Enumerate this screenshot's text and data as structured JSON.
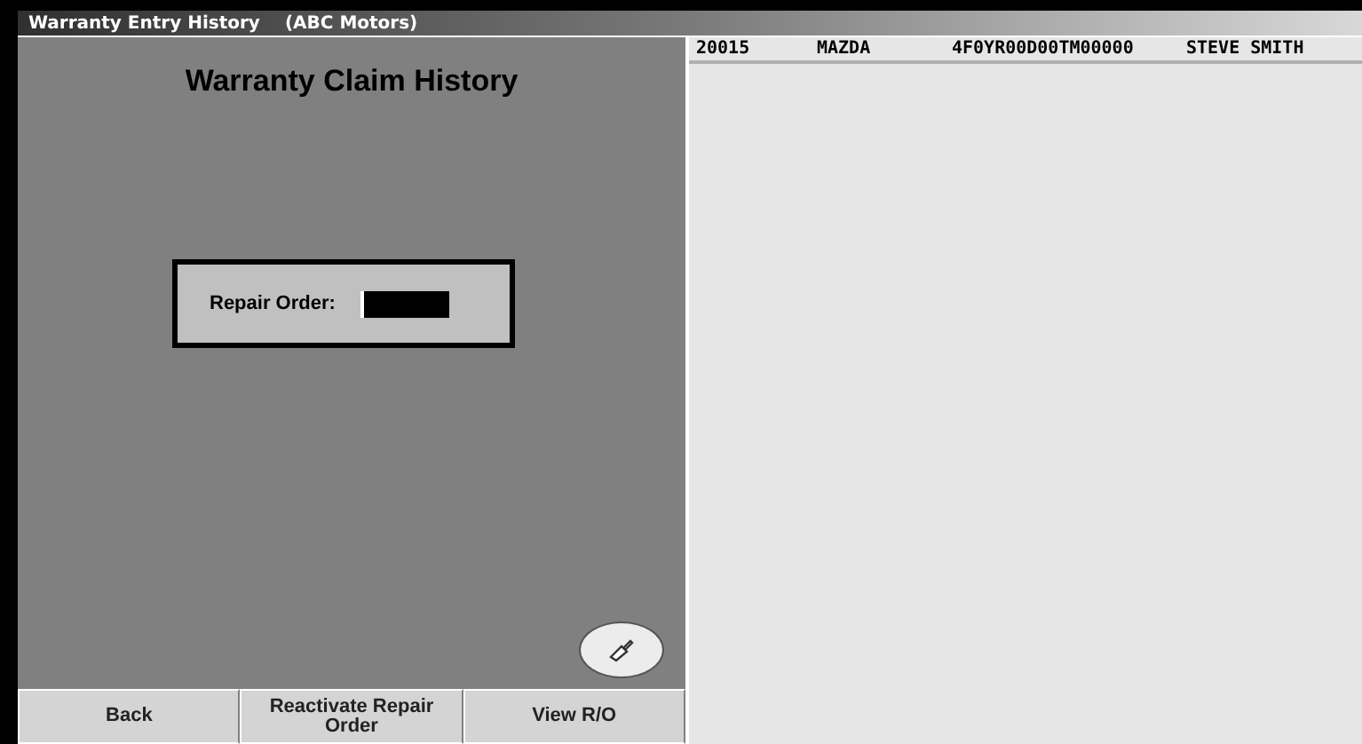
{
  "window": {
    "title": "Warranty Entry History",
    "company": "(ABC Motors)"
  },
  "panel": {
    "heading": "Warranty Claim History",
    "repair_order": {
      "label": "Repair Order:"
    }
  },
  "list": {
    "rows": [
      {
        "cells": [
          "20015",
          "MAZDA",
          "4F0YR00D00TM00000",
          "STEVE SMITH"
        ],
        "selected": false
      }
    ]
  },
  "buttons": [
    "Back",
    "Reactivate Repair Order",
    "View R/O"
  ]
}
